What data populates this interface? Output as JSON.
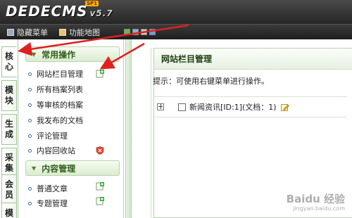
{
  "header": {
    "logo": "DEDECMS",
    "version": "v5.7",
    "badge": "SP1",
    "user_text": ""
  },
  "nav": {
    "hide_menu": "隐藏菜单",
    "site_map": "功能地图"
  },
  "left_tabs": [
    {
      "label": "核心"
    },
    {
      "label": "模块"
    },
    {
      "label": "生成"
    },
    {
      "label": "采集"
    },
    {
      "label": "会员"
    },
    {
      "label": "模"
    }
  ],
  "sidebar": {
    "section1": "常用操作",
    "items1": [
      {
        "label": "网站栏目管理"
      },
      {
        "label": "所有档案列表"
      },
      {
        "label": "等审核的档案"
      },
      {
        "label": "我发布的文档"
      },
      {
        "label": "评论管理"
      },
      {
        "label": "内容回收站"
      }
    ],
    "section2": "内容管理",
    "items2": [
      {
        "label": "普通文章"
      },
      {
        "label": "专题管理"
      }
    ]
  },
  "main": {
    "title": "网站栏目管理",
    "tip": "提示：可使用右键菜单进行操作。",
    "tree_item": "新闻资讯[ID:1](文档：1)"
  },
  "watermark": {
    "line1": "Baidu 经验",
    "line2": "jingyan.baidu.com"
  },
  "colors": {
    "accent": "#3f7f1f",
    "arrow": "#e02020",
    "topbar": "#2e2e2e"
  }
}
